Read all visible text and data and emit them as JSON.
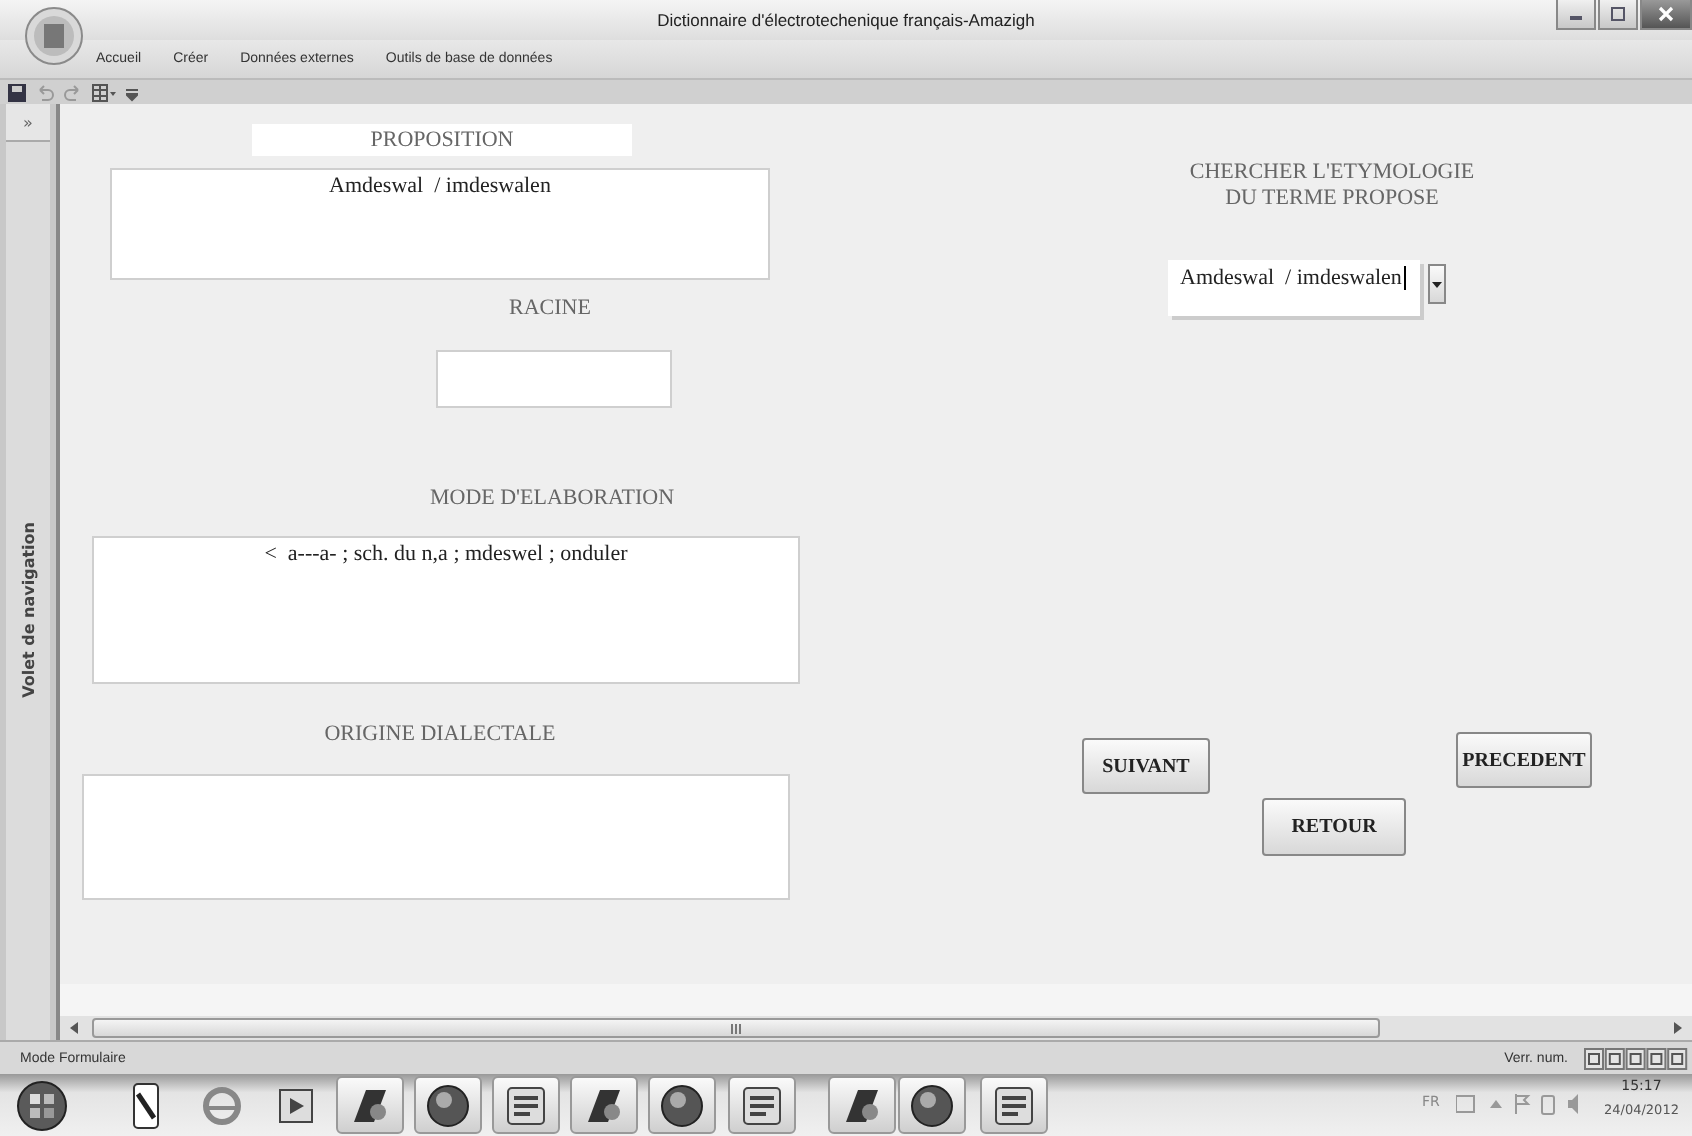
{
  "window": {
    "title": "Dictionnaire d'électrotechenique français-Amazigh"
  },
  "ribbon_tabs": [
    {
      "label": "Accueil"
    },
    {
      "label": "Créer"
    },
    {
      "label": "Données externes"
    },
    {
      "label": "Outils de base de données"
    }
  ],
  "navigation_pane": {
    "toggle": "»",
    "label": "Volet de navigation"
  },
  "form": {
    "proposition": {
      "label": "PROPOSITION",
      "value": "Amdeswal  / imdeswalen"
    },
    "racine": {
      "label": "RACINE"
    },
    "mode_elaboration": {
      "label": "MODE D'ELABORATION",
      "value": "<  a---a- ; sch. du n,a ; mdeswel ; onduler"
    },
    "origine_dialectale": {
      "label": "ORIGINE DIALECTALE"
    },
    "search": {
      "label_lines": [
        "CHERCHER L'ETYMOLOGIE",
        "DU TERME PROPOSE"
      ],
      "value": "Amdeswal  / imdeswalen"
    },
    "buttons": [
      "SUIVANT",
      "RETOUR",
      "PRECEDENT"
    ]
  },
  "status_bar": {
    "mode": "Mode Formulaire",
    "indicator": "Verr. num."
  },
  "taskbar": {
    "language": "FR",
    "time": "15:17",
    "date": "24/04/2012"
  }
}
